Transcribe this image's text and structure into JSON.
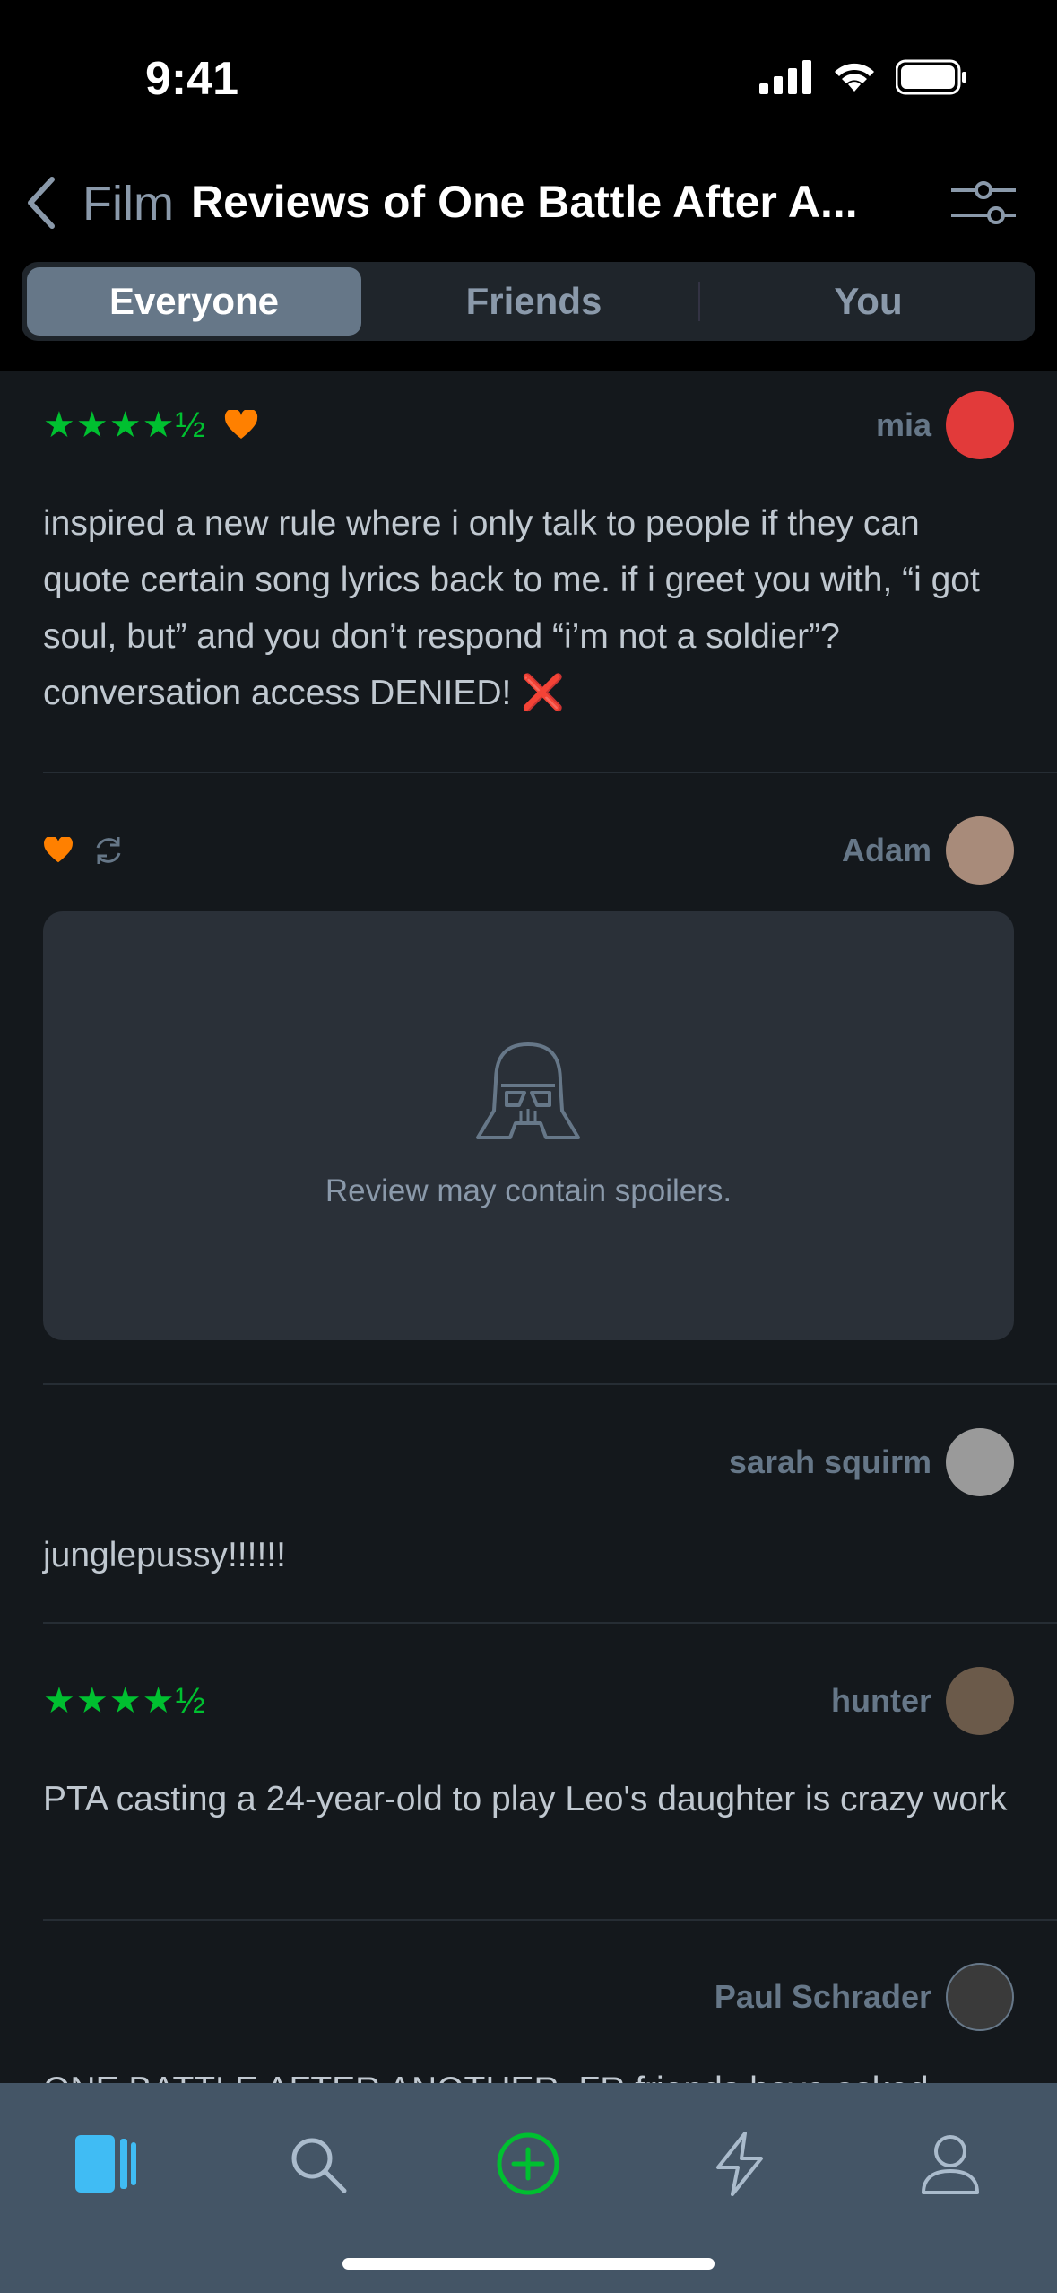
{
  "status": {
    "time": "9:41"
  },
  "header": {
    "crumb": "Film",
    "title": "Reviews of One Battle After A..."
  },
  "tabs": [
    {
      "label": "Everyone"
    },
    {
      "label": "Friends"
    },
    {
      "label": "You"
    }
  ],
  "reviews": [
    {
      "user": "mia",
      "rating": "★★★★½",
      "liked": true,
      "text": "inspired a new rule where i only talk to people if they can quote certain song lyrics back to me. if i greet you with, “i got soul, but” and you don’t respond “i’m not a soldier”? conversation access DENIED! ❌",
      "avatar_color": "#e23a3a"
    },
    {
      "user": "Adam",
      "rating": "",
      "liked": true,
      "rewatch": true,
      "spoiler": "Review may contain spoilers.",
      "avatar_color": "#a88b7a"
    },
    {
      "user": "sarah squirm",
      "rating": "",
      "text": "junglepussy!!!!!!",
      "avatar_color": "#9a9a9a"
    },
    {
      "user": "hunter",
      "rating": "★★★★½",
      "text": "PTA casting a 24-year-old to play Leo's daughter is crazy work",
      "avatar_color": "#6b5a4a"
    },
    {
      "user": "Paul Schrader",
      "rating": "",
      "text": "ONE BATTLE AFTER ANOTHER. FR friends have asked",
      "avatar_color": "#3a3a3a"
    }
  ],
  "colors": {
    "accent_green": "#00c030",
    "heart_orange": "#ff8000",
    "tab_active": "#40bcf4"
  },
  "tabbar_icons": [
    "films-icon",
    "search-icon",
    "add-icon",
    "activity-icon",
    "profile-icon"
  ]
}
